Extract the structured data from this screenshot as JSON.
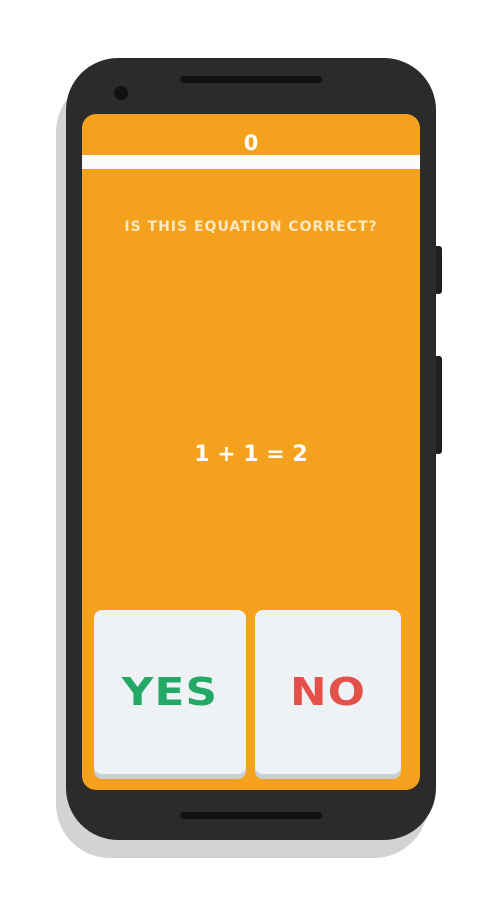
{
  "game": {
    "score": "0",
    "timer_progress": 1.0,
    "question": "IS THIS EQUATION CORRECT?",
    "equation": "1 + 1 = 2",
    "yes_label": "YES",
    "no_label": "NO"
  },
  "colors": {
    "background": "#f4a11d",
    "yes": "#23a866",
    "no": "#e4504a",
    "button": "#eef2f5"
  }
}
